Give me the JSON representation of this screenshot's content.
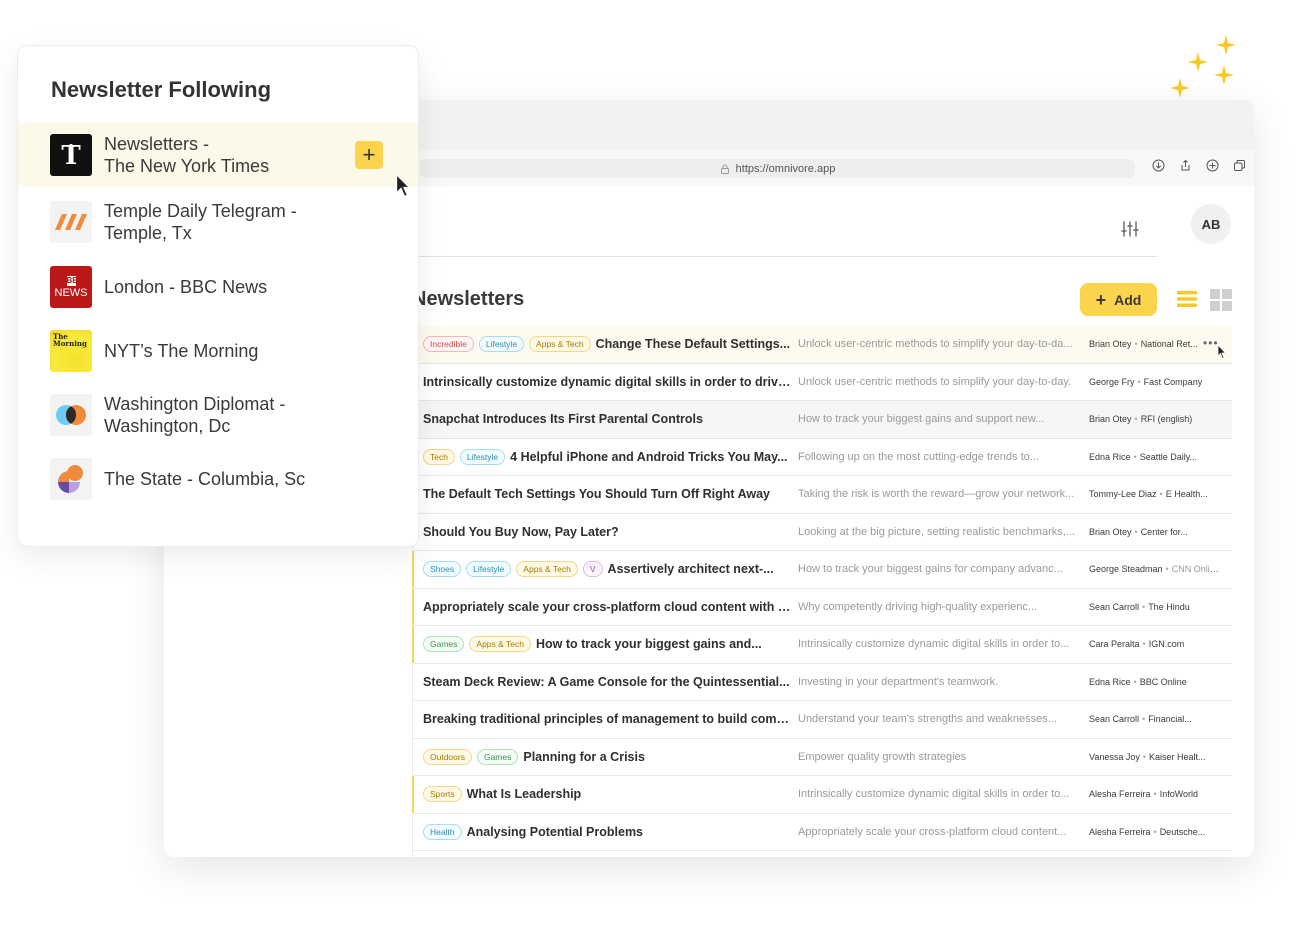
{
  "browser": {
    "url": "https://omnivore.app"
  },
  "header": {
    "avatar_initials": "AB",
    "icons": [
      "filter-icon",
      "list-view-icon",
      "grid-view-icon"
    ]
  },
  "main": {
    "section_title": "Newsletters",
    "add_label": "Add",
    "rows": [
      {
        "tags": [
          {
            "label": "Incredible",
            "color": "red"
          },
          {
            "label": "Lifestyle",
            "color": "blue"
          },
          {
            "label": "Apps & Tech",
            "color": "yellow"
          }
        ],
        "title": "Change These Default Settings...",
        "desc": "Unlock user-centric methods to simplify your day-to-da...",
        "author": "Brian Otey",
        "publisher": "National Ret...",
        "more": "•••"
      },
      {
        "tags": [],
        "title": "Intrinsically customize dynamic digital skills in order to drive...",
        "desc": "Unlock user-centric methods to simplify your day-to-day.",
        "author": "George Fry",
        "publisher": "Fast Company"
      },
      {
        "tags": [],
        "title": "Snapchat Introduces Its First Parental Controls",
        "desc": "How to track your biggest gains and support new...",
        "author": "Brian Otey",
        "publisher": "RFI (english)"
      },
      {
        "tags": [
          {
            "label": "Tech",
            "color": "yellow"
          },
          {
            "label": "Lifestyle",
            "color": "blue"
          }
        ],
        "title": "4 Helpful iPhone and Android Tricks You May...",
        "desc": "Following up on the most cutting-edge trends to...",
        "author": "Edna Rice",
        "publisher": "Seattle Daily..."
      },
      {
        "tags": [],
        "title": "The Default Tech Settings You Should Turn Off Right Away",
        "desc": "Taking the risk is worth the reward—grow your network...",
        "author": "Tommy-Lee Diaz",
        "publisher": "E Health..."
      },
      {
        "tags": [],
        "title": "Should You Buy Now, Pay Later?",
        "desc": "Looking at the big picture, setting realistic benchmarks,...",
        "author": "Brian Otey",
        "publisher": "Center for..."
      },
      {
        "tags": [
          {
            "label": "Shoes",
            "color": "blue"
          },
          {
            "label": "Lifestyle",
            "color": "blue"
          },
          {
            "label": "Apps & Tech",
            "color": "yellow"
          },
          {
            "label": "V",
            "color": "purple"
          }
        ],
        "title": "Assertively architect next-...",
        "desc": "How to track your biggest gains for company advanc...",
        "author": "George Steadman",
        "publisher": "CNN Online"
      },
      {
        "tags": [],
        "title": "Appropriately scale your cross-platform cloud content with ou...",
        "desc": "Why competently driving high-quality experienc...",
        "author": "Sean Carroll",
        "publisher": "The Hindu"
      },
      {
        "tags": [
          {
            "label": "Games",
            "color": "green"
          },
          {
            "label": "Apps & Tech",
            "color": "yellow"
          }
        ],
        "title": "How to track your biggest gains and...",
        "desc": "Intrinsically customize dynamic digital skills in order to...",
        "author": "Cara Peralta",
        "publisher": "IGN.com"
      },
      {
        "tags": [],
        "title": "Steam Deck Review: A Game Console for the Quintessential...",
        "desc": "Investing in your department's teamwork.",
        "author": "Edna Rice",
        "publisher": "BBC Online"
      },
      {
        "tags": [],
        "title": "Breaking traditional principles of management to build compa...",
        "desc": "Understand your team's strengths and weaknesses...",
        "author": "Sean Carroll",
        "publisher": "Financial..."
      },
      {
        "tags": [
          {
            "label": "Outdoors",
            "color": "yellow"
          },
          {
            "label": "Games",
            "color": "green"
          }
        ],
        "title": "Planning for a Crisis",
        "desc": "Empower quality growth strategies",
        "author": "Vanessa Joy",
        "publisher": "Kaiser Healt..."
      },
      {
        "tags": [
          {
            "label": "Sports",
            "color": "yellow"
          }
        ],
        "title": "What Is Leadership",
        "desc": "Intrinsically customize dynamic digital skills in order to...",
        "author": "Alesha Ferreira",
        "publisher": "InfoWorld"
      },
      {
        "tags": [
          {
            "label": "Health",
            "color": "blue"
          }
        ],
        "title": "Analysing Potential Problems",
        "desc": "Appropriately scale your cross-platform cloud content...",
        "author": "Alesha Ferreira",
        "publisher": "Deutsche..."
      }
    ]
  },
  "popup": {
    "title": "Newsletter Following",
    "items": [
      {
        "line1": "Newsletters -",
        "line2": "The New York Times",
        "icon": "nyt-logo-icon"
      },
      {
        "line1": "Temple Daily Telegram -",
        "line2": "Temple, Tx",
        "icon": "temple-telegram-logo-icon"
      },
      {
        "line1": "London - BBC News",
        "line2": "",
        "icon": "bbc-news-logo-icon"
      },
      {
        "line1": "NYT’s The Morning",
        "line2": "",
        "icon": "the-morning-logo-icon"
      },
      {
        "line1": "Washington Diplomat -",
        "line2": "Washington, Dc",
        "icon": "washington-diplomat-logo-icon"
      },
      {
        "line1": "The State - Columbia, Sc",
        "line2": "",
        "icon": "the-state-logo-icon"
      }
    ],
    "plus_label": "+",
    "bbc_logo_text": [
      "BBC",
      "NEWS"
    ],
    "morning_logo_text": [
      "The",
      "Morning"
    ]
  },
  "colors": {
    "accent": "#fcd34d",
    "highlight_row": "#fdfbef",
    "popup_active": "#fdf9e8"
  }
}
